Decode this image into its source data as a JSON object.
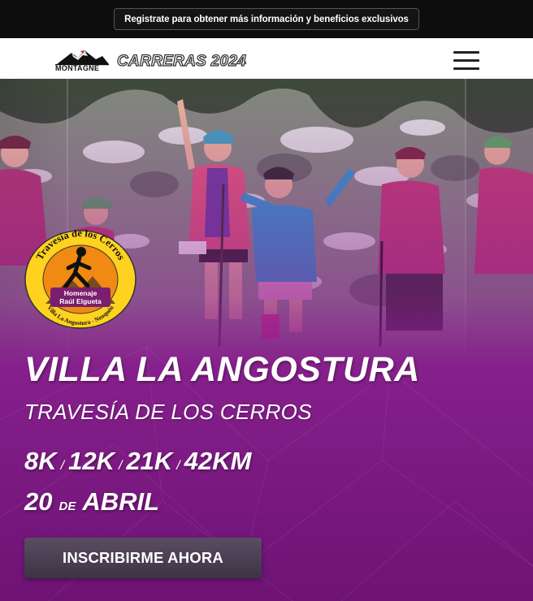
{
  "announcement": {
    "button_label": "Registrate para obtener más información y beneficios exclusivos"
  },
  "header": {
    "logo_text": "MONTAGNE",
    "title": "CARRERAS 2024",
    "menu_icon": "hamburger-menu-icon"
  },
  "hero": {
    "badge": {
      "top_text": "Travesía de los Cerros",
      "middle_text_1": "Homenaje",
      "middle_text_2": "Raúl Elgueta",
      "bottom_text": "Villa La Angostura - Neuquén",
      "colors": {
        "ring": "#ffd21f",
        "center": "#f08a12",
        "banner": "#7b1e6e"
      }
    },
    "title": "VILLA LA ANGOSTURA",
    "subtitle": "TRAVESÍA DE LOS CERROS",
    "distances": [
      "8K",
      "12K",
      "21K",
      "42KM"
    ],
    "distance_separator": "/",
    "date_day": "20",
    "date_de": "DE",
    "date_month": "ABRIL",
    "cta_label": "INSCRIBIRME AHORA",
    "overlay_color": "#8a1a8f"
  }
}
